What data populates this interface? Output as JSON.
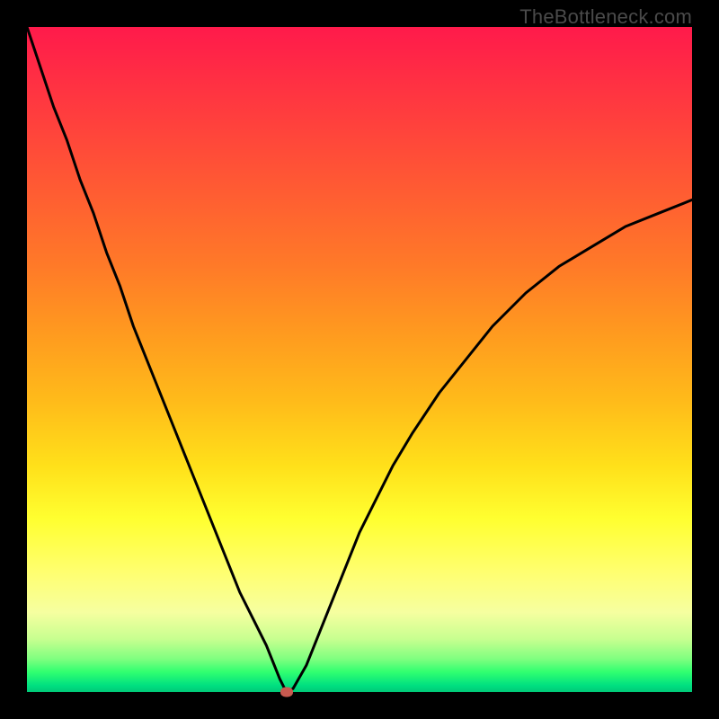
{
  "attribution": "TheBottleneck.com",
  "chart_data": {
    "type": "line",
    "title": "",
    "xlabel": "",
    "ylabel": "",
    "xlim": [
      0,
      100
    ],
    "ylim": [
      0,
      100
    ],
    "gradient_meaning": "bottleneck severity (red high, green none)",
    "curve_vertex_x": 39,
    "x": [
      0,
      2,
      4,
      6,
      8,
      10,
      12,
      14,
      16,
      18,
      20,
      22,
      24,
      26,
      28,
      30,
      32,
      34,
      36,
      38,
      39,
      40,
      42,
      44,
      46,
      48,
      50,
      52,
      55,
      58,
      62,
      66,
      70,
      75,
      80,
      85,
      90,
      95,
      100
    ],
    "y": [
      100,
      94,
      88,
      83,
      77,
      72,
      66,
      61,
      55,
      50,
      45,
      40,
      35,
      30,
      25,
      20,
      15,
      11,
      7,
      2,
      0,
      0.5,
      4,
      9,
      14,
      19,
      24,
      28,
      34,
      39,
      45,
      50,
      55,
      60,
      64,
      67,
      70,
      72,
      74
    ],
    "marker": {
      "x": 39,
      "y": 0
    }
  },
  "colors": {
    "frame": "#000000",
    "curve": "#000000",
    "marker": "#c85a50"
  }
}
